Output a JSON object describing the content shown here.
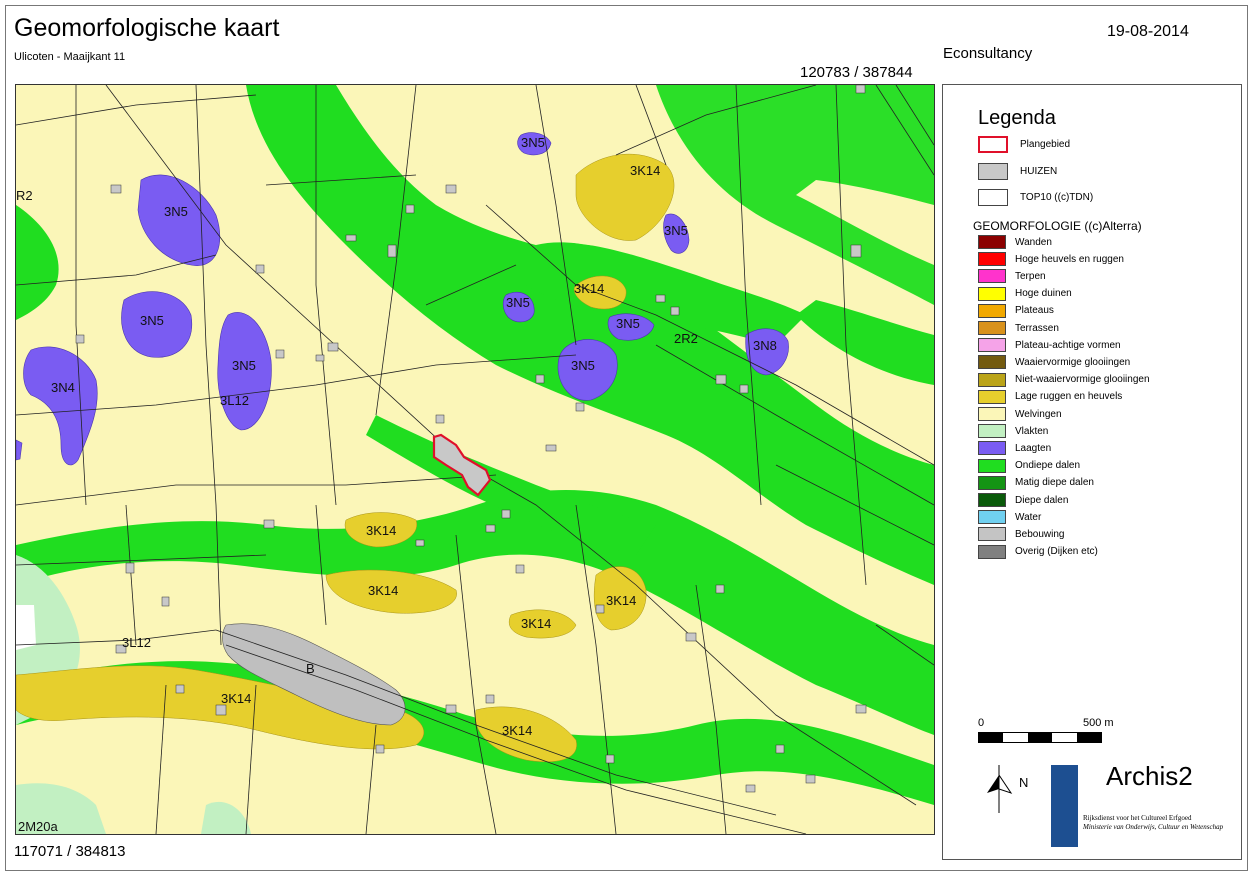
{
  "header": {
    "title": "Geomorfologische kaart",
    "subtitle": "Ulicoten - Maaijkant 11",
    "date": "19-08-2014",
    "company": "Econsultancy",
    "coord_top_right": "120783 / 387844",
    "coord_bottom_left": "117071 / 384813"
  },
  "map": {
    "labels": [
      "3N5",
      "3K14",
      "3N5",
      "3N5",
      "3K14",
      "3N5",
      "3N5",
      "2R2",
      "3N8",
      "3N5",
      "3N5",
      "3N5",
      "3N4",
      "3L12",
      "R2",
      "3K14",
      "3K14",
      "3K14",
      "3K14",
      "3L12",
      "3K14",
      "B",
      "3K14",
      "2M20a"
    ]
  },
  "legend": {
    "title": "Legenda",
    "top_items": [
      {
        "label": "Plangebied",
        "color": "#ffffff",
        "border": "#e0102a"
      },
      {
        "label": "HUIZEN",
        "color": "#c8c8c8",
        "border": "#555555"
      },
      {
        "label": "TOP10 ((c)TDN)",
        "color": "#ffffff",
        "border": "#555555"
      }
    ],
    "section_title": "GEOMORFOLOGIE ((c)Alterra)",
    "items": [
      {
        "label": "Wanden",
        "color": "#8b0000"
      },
      {
        "label": "Hoge heuvels en ruggen",
        "color": "#ff0000"
      },
      {
        "label": "Terpen",
        "color": "#ff33cc"
      },
      {
        "label": "Hoge duinen",
        "color": "#ffff00"
      },
      {
        "label": "Plateaus",
        "color": "#f2a900"
      },
      {
        "label": "Terrassen",
        "color": "#d9921c"
      },
      {
        "label": "Plateau-achtige vormen",
        "color": "#f5a3e8"
      },
      {
        "label": "Waaiervormige glooiingen",
        "color": "#735a0f"
      },
      {
        "label": "Niet-waaiervormige glooiingen",
        "color": "#bba418"
      },
      {
        "label": "Lage ruggen en heuvels",
        "color": "#e6cf2d"
      },
      {
        "label": "Welvingen",
        "color": "#fbf6b8"
      },
      {
        "label": "Vlakten",
        "color": "#c2f0c2"
      },
      {
        "label": "Laagten",
        "color": "#7a5cf2"
      },
      {
        "label": "Ondiepe dalen",
        "color": "#20dd20"
      },
      {
        "label": "Matig diepe dalen",
        "color": "#149414"
      },
      {
        "label": "Diepe dalen",
        "color": "#0a5a0a"
      },
      {
        "label": "Water",
        "color": "#70d0f0"
      },
      {
        "label": "Bebouwing",
        "color": "#c4c4c4"
      },
      {
        "label": "Overig (Dijken etc)",
        "color": "#808080"
      }
    ],
    "scale_start": "0",
    "scale_end": "500 m",
    "north": "N",
    "logo": {
      "name": "Archis2",
      "institution": "Rijksdienst voor het Cultureel Erfgoed",
      "ministry": "Ministerie van Onderwijs, Cultuur en Wetenschap"
    }
  }
}
